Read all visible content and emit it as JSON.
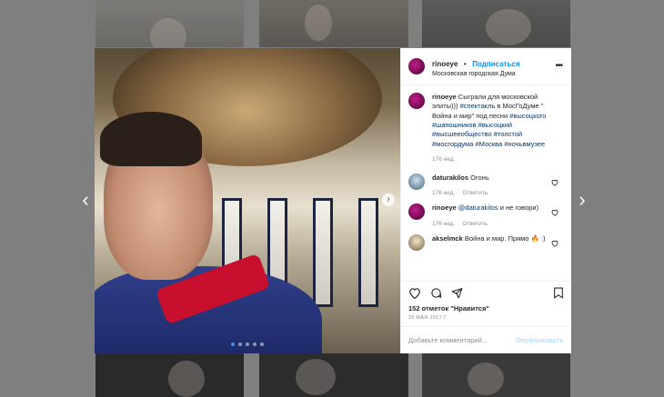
{
  "nav": {
    "prev_icon": "chevron-left-icon",
    "next_icon": "chevron-right-icon",
    "prev_glyph": "‹",
    "next_glyph": "›"
  },
  "post": {
    "username": "rinoeye",
    "follow_label": "Подписаться",
    "separator": "•",
    "location": "Московская городская Дума",
    "more_glyph": "•••",
    "carousel": {
      "slides": 5,
      "active_index": 0
    }
  },
  "comments": [
    {
      "username": "rinoeye",
      "text_parts": [
        {
          "t": "Сыграли для московской элиты))) ",
          "tag": false
        },
        {
          "t": "#спектакль",
          "tag": true
        },
        {
          "t": " в МосГоДуме \" Война и мир\" под песни ",
          "tag": false
        },
        {
          "t": "#высоцкого",
          "tag": true
        },
        {
          "t": " ",
          "tag": false
        },
        {
          "t": "#шапошников",
          "tag": true
        },
        {
          "t": " ",
          "tag": false
        },
        {
          "t": "#высоцкий",
          "tag": true
        },
        {
          "t": " ",
          "tag": false
        },
        {
          "t": "#высшееобщество",
          "tag": true
        },
        {
          "t": " ",
          "tag": false
        },
        {
          "t": "#толстой",
          "tag": true
        },
        {
          "t": " ",
          "tag": false
        },
        {
          "t": "#мосгордума",
          "tag": true
        },
        {
          "t": " ",
          "tag": false
        },
        {
          "t": "#Москва",
          "tag": true
        },
        {
          "t": " ",
          "tag": false
        },
        {
          "t": "#ночьвмузее",
          "tag": true
        }
      ],
      "age": "176 нед.",
      "reply_label": ""
    },
    {
      "username": "daturakilos",
      "text_parts": [
        {
          "t": "Огонь",
          "tag": false
        }
      ],
      "age": "176 нед.",
      "reply_label": "Ответить"
    },
    {
      "username": "rinoeye",
      "text_parts": [
        {
          "t": "@daturakilos",
          "tag": true
        },
        {
          "t": " и не говори)",
          "tag": false
        }
      ],
      "age": "176 нед.",
      "reply_label": "Ответить"
    },
    {
      "username": "akselmck",
      "text_parts": [
        {
          "t": "Война и мир. Прямо 🔥 :)",
          "tag": false
        }
      ],
      "age": "",
      "reply_label": ""
    }
  ],
  "actions": {
    "like_icon": "heart-icon",
    "comment_icon": "comment-icon",
    "share_icon": "share-icon",
    "save_icon": "bookmark-icon"
  },
  "likes_text": "152 отметок \"Нравится\"",
  "date_text": "20 МАЯ 2017 Г.",
  "comment_box": {
    "placeholder": "Добавьте комментарий...",
    "post_label": "Опубликовать"
  },
  "colors": {
    "link": "#00376b",
    "follow": "#0095f6",
    "post_disabled": "#b2dffc",
    "overlay": "#7f7f7f"
  }
}
